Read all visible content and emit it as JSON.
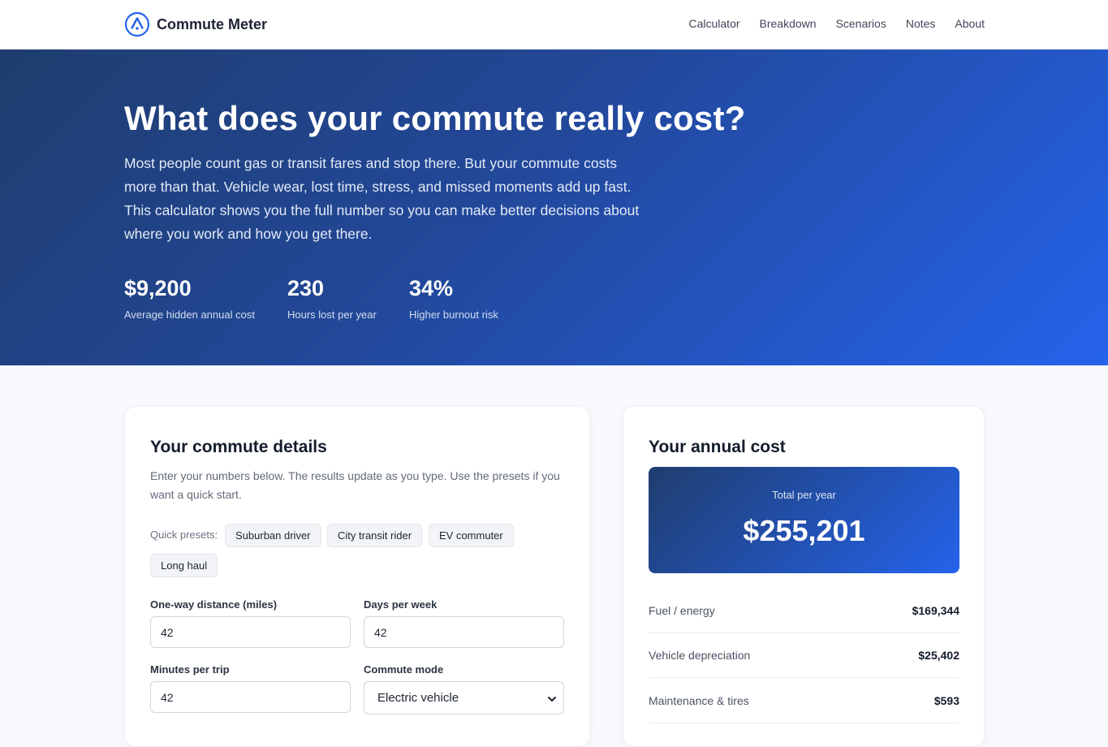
{
  "nav": {
    "brand": "Commute Meter",
    "logo_icon": "navigation-arrow-icon",
    "links": [
      "Calculator",
      "Breakdown",
      "Scenarios",
      "Notes",
      "About"
    ]
  },
  "hero": {
    "title": "What does your commute really cost?",
    "description": "Most people count gas or transit fares and stop there. But your commute costs more than that. Vehicle wear, lost time, stress, and missed moments add up fast. This calculator shows you the full number so you can make better decisions about where you work and how you get there.",
    "stats": [
      {
        "value": "$9,200",
        "label": "Average hidden annual cost"
      },
      {
        "value": "230",
        "label": "Hours lost per year"
      },
      {
        "value": "34%",
        "label": "Higher burnout risk"
      }
    ]
  },
  "details": {
    "title": "Your commute details",
    "intro": "Enter your numbers below. The results update as you type. Use the presets if you want a quick start.",
    "presets_label": "Quick presets:",
    "presets": [
      "Suburban driver",
      "City transit rider",
      "EV commuter",
      "Long haul"
    ],
    "fields": {
      "distance": {
        "label": "One-way distance (miles)",
        "value": "42"
      },
      "days": {
        "label": "Days per week",
        "value": "42"
      },
      "minutes": {
        "label": "Minutes per trip",
        "value": "42"
      },
      "mode": {
        "label": "Commute mode",
        "value": "Electric vehicle"
      }
    }
  },
  "result": {
    "title": "Your annual cost",
    "total_label": "Total per year",
    "total_value": "$255,201",
    "breakdown": [
      {
        "label": "Fuel / energy",
        "value": "$169,344"
      },
      {
        "label": "Vehicle depreciation",
        "value": "$25,402"
      },
      {
        "label": "Maintenance & tires",
        "value": "$593"
      }
    ]
  },
  "colors": {
    "accent": "#2563eb",
    "hero_dark": "#1f3d6e"
  }
}
